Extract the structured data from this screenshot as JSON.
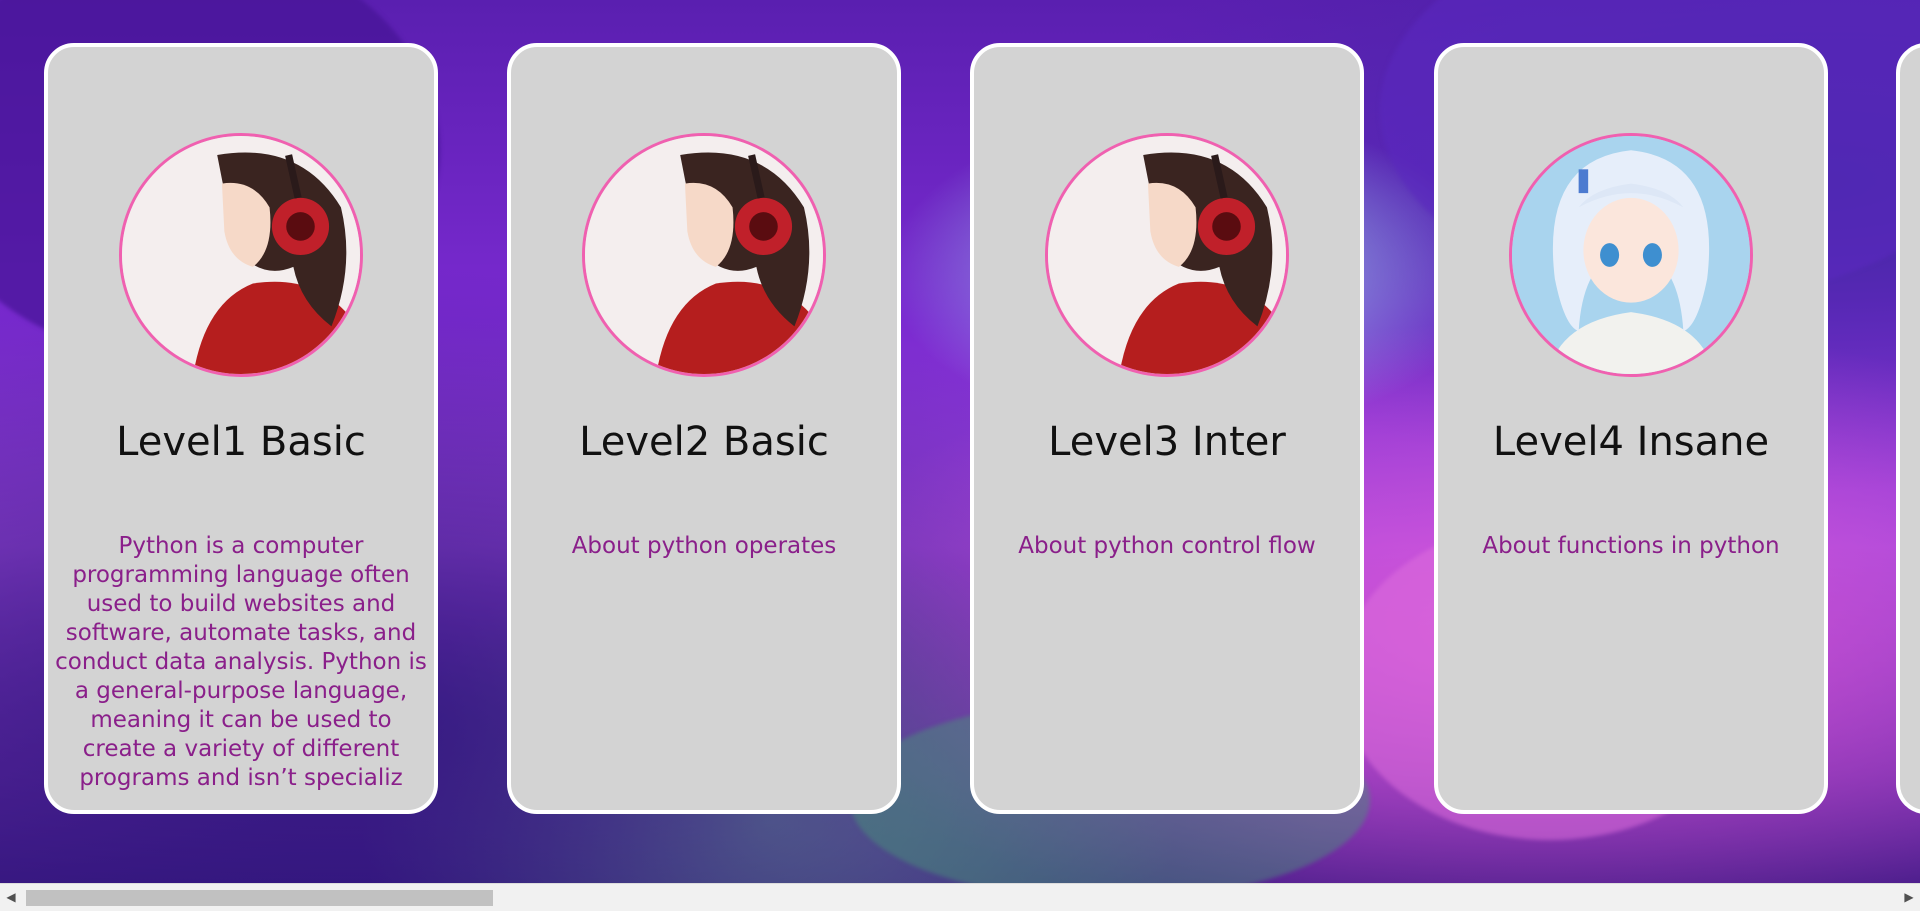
{
  "cards": [
    {
      "title": "Level1 Basic",
      "description": "Python is a computer programming language often used to build websites and software, automate tasks, and conduct data analysis. Python is a general-purpose language, meaning it can be used to create a variety of different programs and isn’t specializ",
      "avatar_icon": "anime-girl-headphones-avatar"
    },
    {
      "title": "Level2 Basic",
      "description": "About python operates",
      "avatar_icon": "anime-girl-headphones-avatar"
    },
    {
      "title": "Level3 Inter",
      "description": "About python control flow",
      "avatar_icon": "anime-girl-headphones-avatar"
    },
    {
      "title": "Level4 Insane",
      "description": "About functions in python",
      "avatar_icon": "anime-girl-white-hair-avatar"
    }
  ],
  "scrollbar": {
    "left_arrow_icon": "scroll-left-arrow-icon",
    "right_arrow_icon": "scroll-right-arrow-icon",
    "left_glyph": "◀",
    "right_glyph": "▶"
  },
  "colors": {
    "card_background": "#d3d3d3",
    "card_border": "#ffffff",
    "avatar_border": "#f060b0",
    "description_text": "#8a1f8a",
    "title_text": "#111111"
  }
}
